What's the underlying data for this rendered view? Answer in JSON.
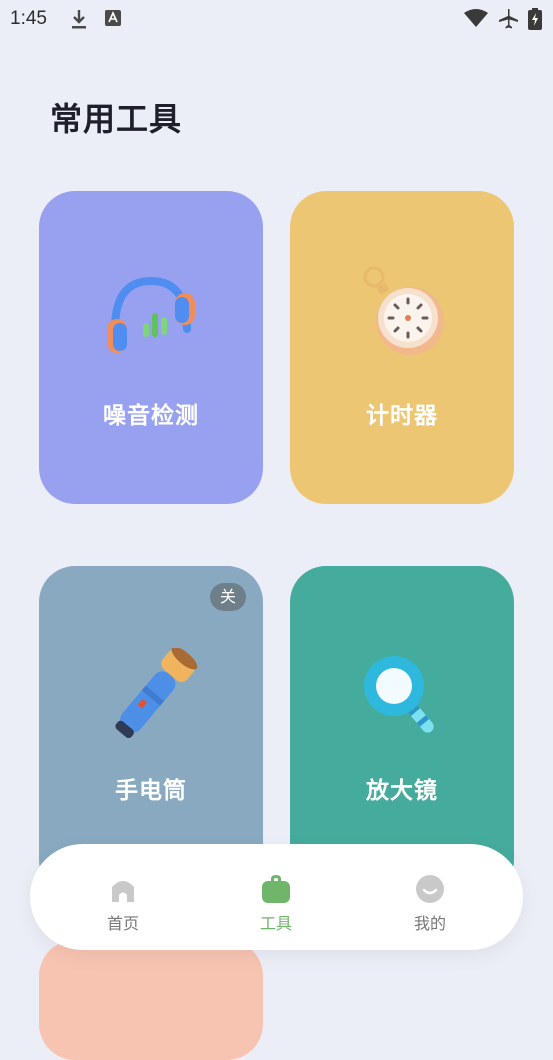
{
  "status_bar": {
    "time": "1:45"
  },
  "header": {
    "title": "常用工具"
  },
  "tools": [
    {
      "label": "噪音检测",
      "icon": "headphones-icon",
      "color": "#97a1ef"
    },
    {
      "label": "计时器",
      "icon": "stopwatch-icon",
      "color": "#ecc673"
    },
    {
      "label": "手电筒",
      "icon": "flashlight-icon",
      "color": "#89a9c1",
      "toggle": "关"
    },
    {
      "label": "放大镜",
      "icon": "magnifier-icon",
      "color": "#45ab9c"
    }
  ],
  "nav": {
    "items": [
      {
        "label": "首页",
        "icon": "home-icon"
      },
      {
        "label": "工具",
        "icon": "toolbox-icon",
        "active": true
      },
      {
        "label": "我的",
        "icon": "profile-icon"
      }
    ],
    "active_color": "#6fb56a",
    "inactive_color": "#c9c9c9"
  }
}
